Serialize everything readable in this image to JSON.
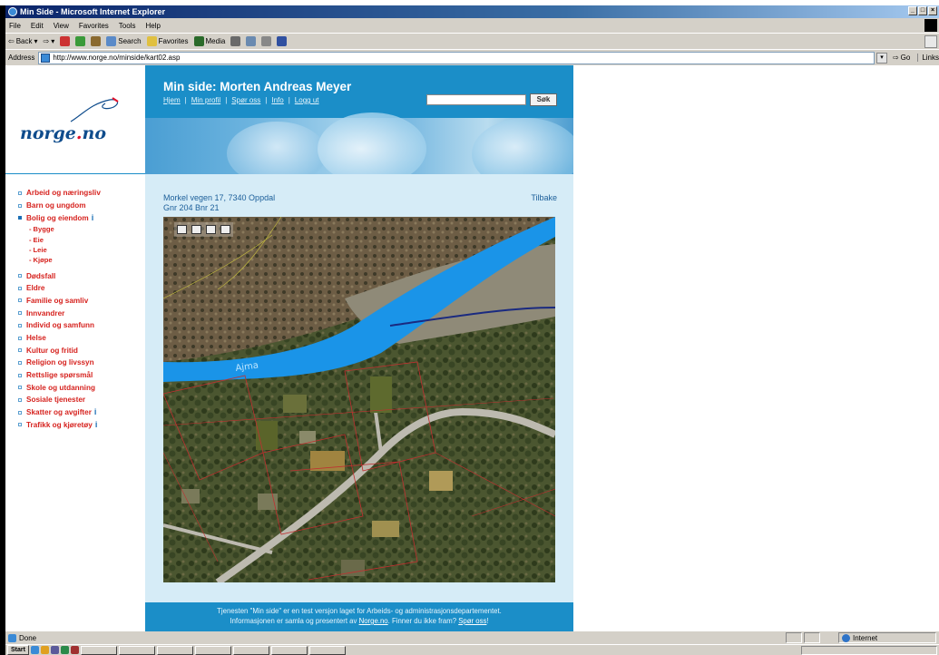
{
  "window": {
    "title": "Min Side - Microsoft Internet Explorer",
    "controls": [
      "minimize-icon",
      "maximize-icon",
      "close-icon"
    ]
  },
  "menubar": {
    "items": [
      "File",
      "Edit",
      "View",
      "Favorites",
      "Tools",
      "Help"
    ]
  },
  "toolbar": {
    "back_label": "Back",
    "search_label": "Search",
    "favorites_label": "Favorites",
    "media_label": "Media"
  },
  "address": {
    "label": "Address",
    "url": "http://www.norge.no/minside/kart02.asp",
    "go_label": "Go",
    "links_label": "Links"
  },
  "site": {
    "logo_text_main": "norge",
    "logo_text_dot": ".",
    "logo_text_tld": "no",
    "page_title": "Min side: Morten Andreas Meyer",
    "top_links": [
      "Hjem",
      "Min profil",
      "Spør oss",
      "Info",
      "Logg ut"
    ],
    "search_button": "Søk",
    "search_value": ""
  },
  "nav": {
    "items": [
      {
        "label": "Arbeid og næringsliv",
        "active": false,
        "info": false
      },
      {
        "label": "Barn og ungdom",
        "active": false,
        "info": false
      },
      {
        "label": "Bolig og eiendom",
        "active": true,
        "info": true
      },
      {
        "label": "Dødsfall",
        "active": false,
        "info": false
      },
      {
        "label": "Eldre",
        "active": false,
        "info": false
      },
      {
        "label": "Familie og samliv",
        "active": false,
        "info": false
      },
      {
        "label": "Innvandrer",
        "active": false,
        "info": false
      },
      {
        "label": "Individ og samfunn",
        "active": false,
        "info": false
      },
      {
        "label": "Helse",
        "active": false,
        "info": false
      },
      {
        "label": "Kultur og fritid",
        "active": false,
        "info": false
      },
      {
        "label": "Religion og livssyn",
        "active": false,
        "info": false
      },
      {
        "label": "Rettslige spørsmål",
        "active": false,
        "info": false
      },
      {
        "label": "Skole og utdanning",
        "active": false,
        "info": false
      },
      {
        "label": "Sosiale tjenester",
        "active": false,
        "info": false
      },
      {
        "label": "Skatter og avgifter",
        "active": false,
        "info": true
      },
      {
        "label": "Trafikk og kjøretøy",
        "active": false,
        "info": true
      }
    ],
    "sub_items": [
      "Bygge",
      "Eie",
      "Leie",
      "Kjøpe"
    ]
  },
  "content": {
    "address_line1": "Morkel vegen 17, 7340 Oppdal",
    "address_line2": "Gnr 204 Bnr 21",
    "back_link": "Tilbake",
    "map_river_label": "Ajma",
    "map_tools": [
      "save-icon",
      "print-icon",
      "email-icon",
      "clipboard-icon"
    ]
  },
  "footer": {
    "line1": "Tjenesten \"Min side\" er en test versjon laget for Arbeids- og administrasjonsdepartementet.",
    "line2_pre": "Informasjonen er samla og presentert av ",
    "line2_link1": "Norge.no",
    "line2_mid": ". Finner du ikke fram? ",
    "line2_link2": "Spør oss",
    "line2_post": "!"
  },
  "status": {
    "text": "Done",
    "zone": "Internet"
  },
  "taskbar": {
    "start_label": "Start"
  },
  "colors": {
    "accent_blue": "#1b8ec8",
    "nav_red": "#d6231f",
    "content_bg": "#d6ecf7"
  }
}
